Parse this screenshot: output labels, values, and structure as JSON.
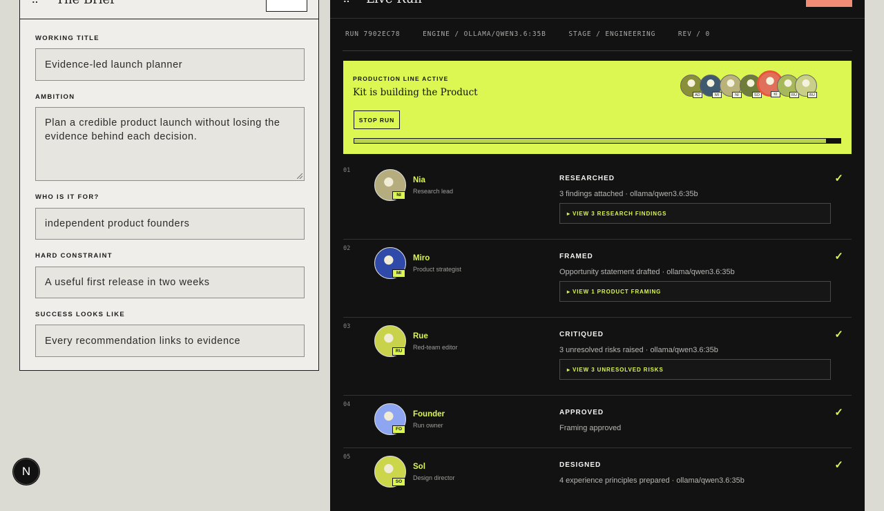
{
  "brief": {
    "title": "The Brief",
    "fields": [
      {
        "label": "WORKING TITLE",
        "value": "Evidence-led launch planner"
      },
      {
        "label": "AMBITION",
        "value": "Plan a credible product launch without losing the evidence behind each decision."
      },
      {
        "label": "WHO IS IT FOR?",
        "value": "independent product founders"
      },
      {
        "label": "HARD CONSTRAINT",
        "value": "A useful first release in two weeks"
      },
      {
        "label": "SUCCESS LOOKS LIKE",
        "value": "Every recommendation links to evidence"
      }
    ]
  },
  "fab": {
    "label": "N"
  },
  "live": {
    "title": "Live Run",
    "meta": {
      "run": "RUN 7902EC78",
      "engine": "ENGINE / OLLAMA/QWEN3.6:35B",
      "stage": "STAGE / ENGINEERING",
      "rev": "REV / 0"
    },
    "banner": {
      "kicker": "PRODUCTION LINE ACTIVE",
      "headline": "Kit is building the Product",
      "stop_label": "STOP RUN",
      "progress": 0.97,
      "crew": [
        {
          "tag": "AD",
          "color": "#8a8f3a"
        },
        {
          "tag": "MI",
          "color": "#3f5a6e"
        },
        {
          "tag": "NI",
          "color": "#b9b27a"
        },
        {
          "tag": "SO",
          "color": "#6f7d3a"
        },
        {
          "tag": "KI",
          "color": "#e0705a",
          "active": true
        },
        {
          "tag": "RU",
          "color": "#a7b85a"
        },
        {
          "tag": "BU",
          "color": "#c9cf88"
        }
      ]
    },
    "steps": [
      {
        "num": "01",
        "name": "Nia",
        "role": "Research lead",
        "tag": "NI",
        "status": "RESEARCHED",
        "detail": "3 findings attached · ollama/qwen3.6:35b",
        "view": "▸ VIEW 3 RESEARCH FINDINGS",
        "avatar_color": "#b5ad7e",
        "check": "✓"
      },
      {
        "num": "02",
        "name": "Miro",
        "role": "Product strategist",
        "tag": "MI",
        "status": "FRAMED",
        "detail": "Opportunity statement drafted · ollama/qwen3.6:35b",
        "view": "▸ VIEW 1 PRODUCT FRAMING",
        "avatar_color": "#2f4aa8",
        "check": "✓"
      },
      {
        "num": "03",
        "name": "Rue",
        "role": "Red-team editor",
        "tag": "RU",
        "status": "CRITIQUED",
        "detail": "3 unresolved risks raised · ollama/qwen3.6:35b",
        "view": "▸ VIEW 3 UNRESOLVED RISKS",
        "avatar_color": "#c8d24a",
        "check": "✓"
      },
      {
        "num": "04",
        "name": "Founder",
        "role": "Run owner",
        "tag": "FO",
        "status": "APPROVED",
        "detail": "Framing approved",
        "view": "",
        "avatar_color": "#8ea6f2",
        "check": "✓"
      },
      {
        "num": "05",
        "name": "Sol",
        "role": "Design director",
        "tag": "SO",
        "status": "DESIGNED",
        "detail": "4 experience principles prepared · ollama/qwen3.6:35b",
        "view": "",
        "avatar_color": "#cbd64a",
        "check": "✓"
      }
    ]
  }
}
